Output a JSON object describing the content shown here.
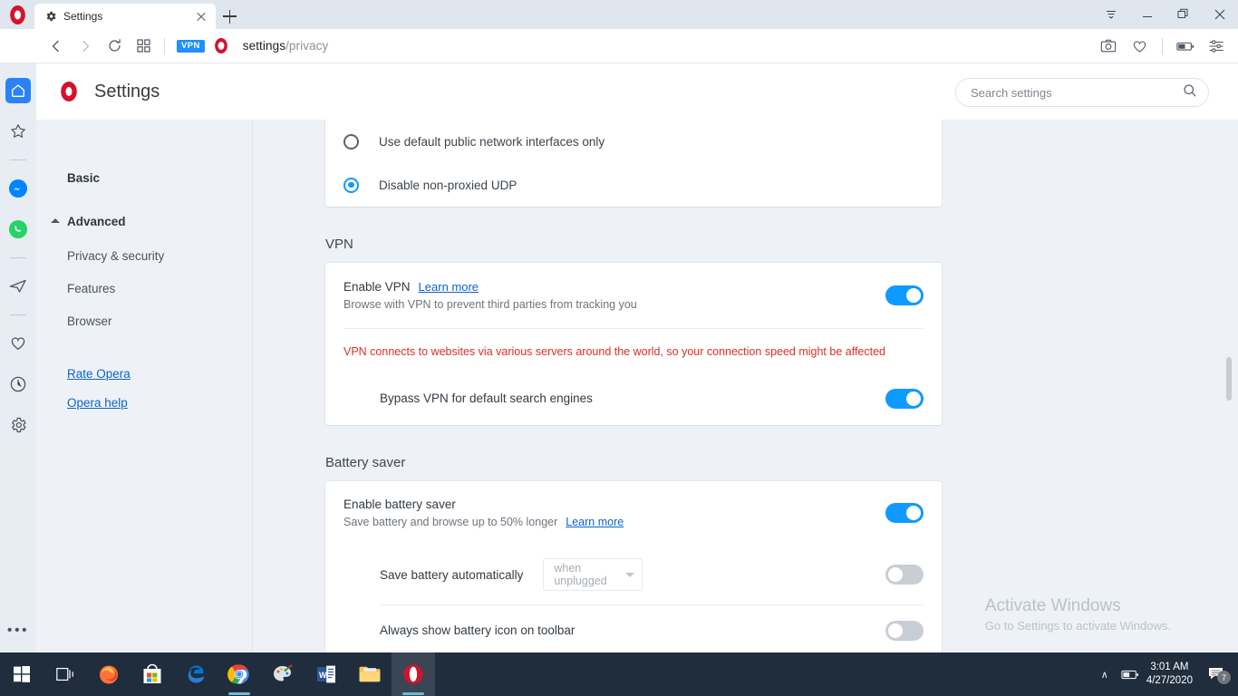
{
  "window": {
    "tab": {
      "title": "Settings",
      "favicon": "gear-icon"
    },
    "controls": [
      "tab-menu-icon",
      "minimize-icon",
      "restore-icon",
      "close-icon"
    ]
  },
  "navbar": {
    "back": "back-icon",
    "forward": "forward-icon",
    "reload": "reload-icon",
    "speeddial": "speed-dial-icon",
    "vpn_badge": "VPN",
    "url_main": "settings",
    "url_dim": "/privacy",
    "right_icons": [
      "snapshot-icon",
      "heart-icon",
      "battery-icon",
      "easy-setup-icon"
    ]
  },
  "rail": {
    "items": [
      {
        "name": "home-icon",
        "active": true
      },
      {
        "name": "speed-dial-star-icon",
        "active": false
      },
      {
        "name": "messenger-icon",
        "active": false
      },
      {
        "name": "whatsapp-icon",
        "active": false
      },
      {
        "name": "telegram-icon",
        "active": false
      },
      {
        "name": "favorites-heart-icon",
        "active": false
      },
      {
        "name": "history-clock-icon",
        "active": false
      },
      {
        "name": "settings-gear-icon",
        "active": false
      }
    ],
    "more": "•••"
  },
  "settings": {
    "header_title": "Settings",
    "search": {
      "placeholder": "Search settings",
      "value": ""
    },
    "nav": {
      "basic": "Basic",
      "advanced": "Advanced",
      "items": [
        {
          "label": "Privacy & security"
        },
        {
          "label": "Features"
        },
        {
          "label": "Browser"
        }
      ],
      "links": [
        {
          "label": "Rate Opera"
        },
        {
          "label": "Opera help"
        }
      ]
    },
    "webrtc": {
      "options": [
        {
          "label": "Use default public network interfaces only",
          "selected": false
        },
        {
          "label": "Disable non-proxied UDP",
          "selected": true
        }
      ]
    },
    "vpn": {
      "section_title": "VPN",
      "enable_label": "Enable VPN",
      "enable_learn_more": "Learn more",
      "enable_sub": "Browse with VPN to prevent third parties from tracking you",
      "enable_on": true,
      "warning": "VPN connects to websites via various servers around the world, so your connection speed might be affected",
      "warning_color": "#d93025",
      "bypass_label": "Bypass VPN for default search engines",
      "bypass_on": true
    },
    "battery": {
      "section_title": "Battery saver",
      "enable_label": "Enable battery saver",
      "enable_sub": "Save battery and browse up to 50% longer",
      "enable_learn_more": "Learn more",
      "enable_on": true,
      "auto_label": "Save battery automatically",
      "auto_select_value": "when unplugged",
      "auto_on": false,
      "toolbar_label": "Always show battery icon on toolbar",
      "toolbar_on": false
    }
  },
  "watermark": {
    "line1": "Activate Windows",
    "line2": "Go to Settings to activate Windows."
  },
  "taskbar": {
    "items": [
      {
        "name": "start-button"
      },
      {
        "name": "task-view-button"
      },
      {
        "name": "firefox-icon"
      },
      {
        "name": "microsoft-store-icon"
      },
      {
        "name": "edge-icon"
      },
      {
        "name": "chrome-icon"
      },
      {
        "name": "paint-icon"
      },
      {
        "name": "word-icon"
      },
      {
        "name": "file-explorer-icon"
      },
      {
        "name": "opera-icon"
      }
    ],
    "tray": {
      "caret": "∧",
      "battery": "battery-icon",
      "time": "3:01 AM",
      "date": "4/27/2020",
      "notification_count": "7"
    }
  },
  "colors": {
    "accent_blue": "#0f9aff",
    "opera_red": "#d5122b",
    "link_blue": "#0d64c8",
    "warning_red": "#d93025",
    "taskbar": "#1f2d3d"
  }
}
